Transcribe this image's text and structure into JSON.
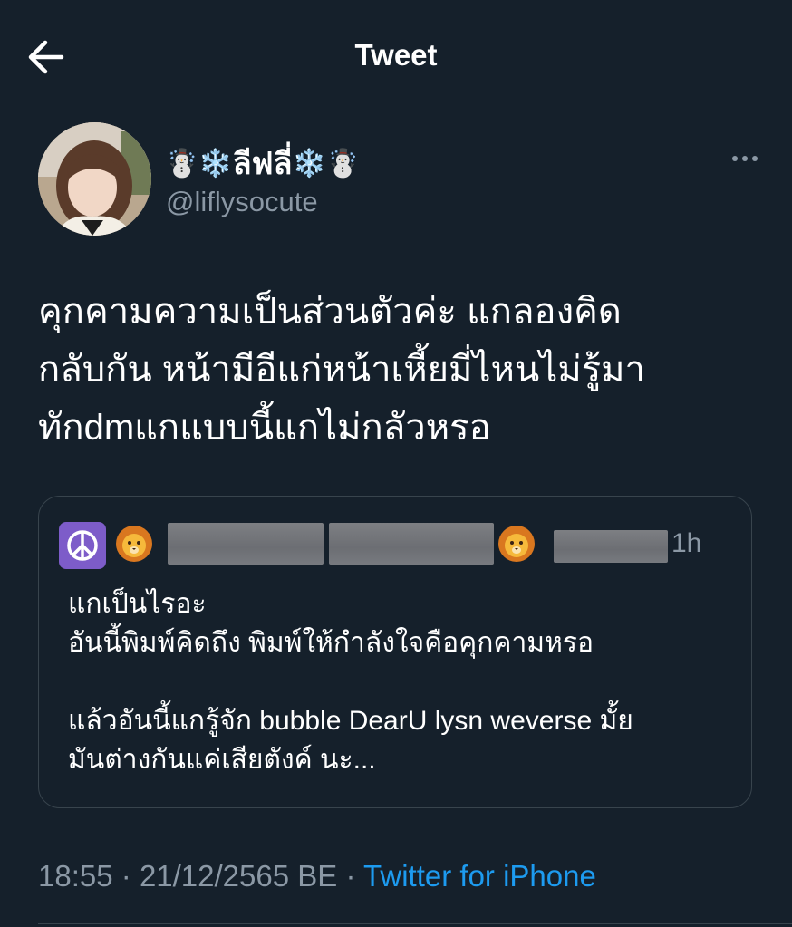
{
  "header": {
    "title": "Tweet",
    "back_icon": "arrow-left-icon"
  },
  "author": {
    "display_name_prefix": "☃️❄️",
    "display_name_core": "ลีฟลี่",
    "display_name_suffix": "❄️☃️",
    "handle": "@liflysocute",
    "avatar_icon": "profile-photo",
    "more_icon": "more-horizontal-icon"
  },
  "tweet": {
    "lines": [
      "คุกคามความเป็นส่วนตัวค่ะ แกลองคิด",
      "กลับกัน หน้ามีอีแก่หน้าเหี้ยมี่ไหนไม่รู้มา",
      "ทักdmแกแบบนี้แกไม่กลัวหรอ"
    ]
  },
  "quote": {
    "time": "1h",
    "icons": [
      "peace-symbol-icon",
      "lion-face-icon"
    ],
    "body_lines": [
      "แกเป็นไรอะ",
      "อันนี้พิมพ์คิดถึง พิมพ์ให้กำลังใจคือคุกคามหรอ",
      "",
      "แล้วอันนี้แกรู้จัก bubble DearU lysn weverse มั้ย",
      "มันต่างกันแค่เสียตังค์ นะ..."
    ]
  },
  "meta": {
    "time": "18:55",
    "date": "21/12/2565 BE",
    "separator": "·",
    "source": "Twitter for iPhone"
  },
  "colors": {
    "background": "#15202b",
    "text": "#ffffff",
    "secondary": "#8b98a5",
    "accent": "#1d9bf0",
    "border": "#38444d"
  }
}
